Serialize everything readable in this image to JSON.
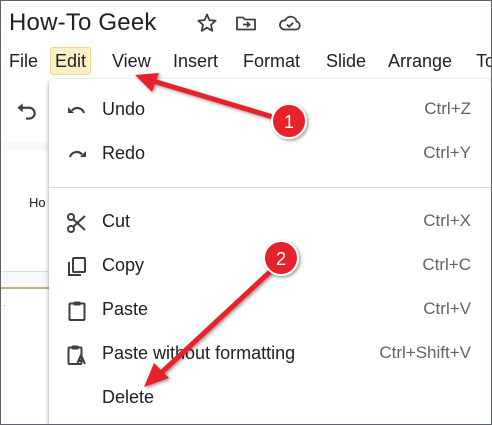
{
  "app": {
    "doc_title": "How-To Geek",
    "title_icons": [
      "star-icon",
      "move-to-folder-icon",
      "cloud-saved-icon"
    ]
  },
  "menubar": {
    "items": [
      "File",
      "Edit",
      "View",
      "Insert",
      "Format",
      "Slide",
      "Arrange",
      "To"
    ],
    "active": "Edit"
  },
  "slide_panel": {
    "thumbnail_text": "Ho"
  },
  "edit_menu": {
    "items": [
      {
        "label": "Undo",
        "shortcut": "Ctrl+Z",
        "icon": "undo-icon"
      },
      {
        "label": "Redo",
        "shortcut": "Ctrl+Y",
        "icon": "redo-icon"
      },
      {
        "label": "Cut",
        "shortcut": "Ctrl+X",
        "icon": "scissors-icon"
      },
      {
        "label": "Copy",
        "shortcut": "Ctrl+C",
        "icon": "copy-icon"
      },
      {
        "label": "Paste",
        "shortcut": "Ctrl+V",
        "icon": "clipboard-icon"
      },
      {
        "label": "Paste without formatting",
        "shortcut": "Ctrl+Shift+V",
        "icon": "paste-plain-icon"
      },
      {
        "label": "Delete",
        "shortcut": "",
        "icon": ""
      }
    ]
  },
  "annotations": {
    "badge_1": "1",
    "badge_2": "2",
    "arrow_color": "#e8242c"
  }
}
